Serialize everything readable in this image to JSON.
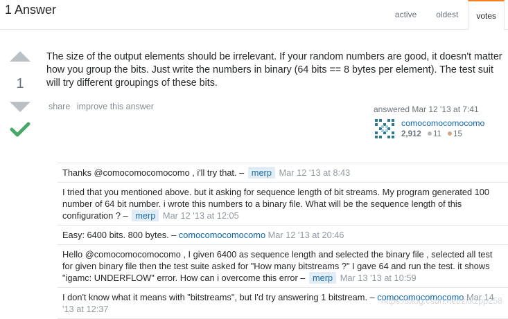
{
  "header": {
    "answers_count": "1 Answer",
    "tabs": [
      "active",
      "oldest",
      "votes"
    ],
    "selected_tab": "votes"
  },
  "votes": {
    "count": "1",
    "accepted": true,
    "up_icon": "arrow-up-icon",
    "down_icon": "arrow-down-icon",
    "accepted_icon": "checkmark-icon"
  },
  "answer": {
    "body": "The size of the output elements should be irrelevant. If your random numbers are good, it doesn't matter how you group the bits. Just write the numbers in binary (64 bits == 8 bytes per element). The test suit will try different groupings of these bits.",
    "menu": {
      "share": "share",
      "improve": "improve this answer"
    },
    "user_info": {
      "action_time": "answered Mar 12 '13 at 7:41",
      "name": "comocomocomocomo",
      "reputation": "2,912",
      "silver": "11",
      "bronze": "15"
    }
  },
  "comments": [
    {
      "pre": "Thanks @comocomocomocomo , i'll try that. – ",
      "user": "merp",
      "user_style": "tag",
      "date": "Mar 12 '13 at 8:43"
    },
    {
      "pre": "I tried that you mentioned above. but it asking for sequence length of bit streams. My program generated 100 number of 64 bit number. i wrote this numbers to a binary file. What will be the sequence length of this configuration ? – ",
      "user": "merp",
      "user_style": "tag",
      "date": "Mar 12 '13 at 12:05"
    },
    {
      "pre": "Easy: 6400 bits. 800 bytes. – ",
      "user": "comocomocomocomo",
      "user_style": "link",
      "date": "Mar 12 '13 at 20:46"
    },
    {
      "pre": "Hello @comocomocomocomo , I given 6400 as sequence length and selected the binary file , selected all test for given binary file then the test suite asked for \"How many bitstreams ?\" I gave 64 and run the test. it shows \"igamc: UNDERFLOW\" error. How can i overcome this error – ",
      "user": "merp",
      "user_style": "tag",
      "date": "Mar 13 '13 at 10:59"
    },
    {
      "pre": "I don't know what it means with \"bitstreams\", but I'd try answering 1 bitstream. – ",
      "user": "comocomocomocomo",
      "user_style": "link",
      "date": "Mar 14 '13 at 12:37"
    }
  ],
  "watermark": "https://blog.csdn.net/zxkzpp258",
  "colors": {
    "accent": "#f48024",
    "link": "#0c67b0",
    "accepted": "#48a868",
    "silver": "#b4b8bc",
    "bronze": "#d1a684"
  }
}
